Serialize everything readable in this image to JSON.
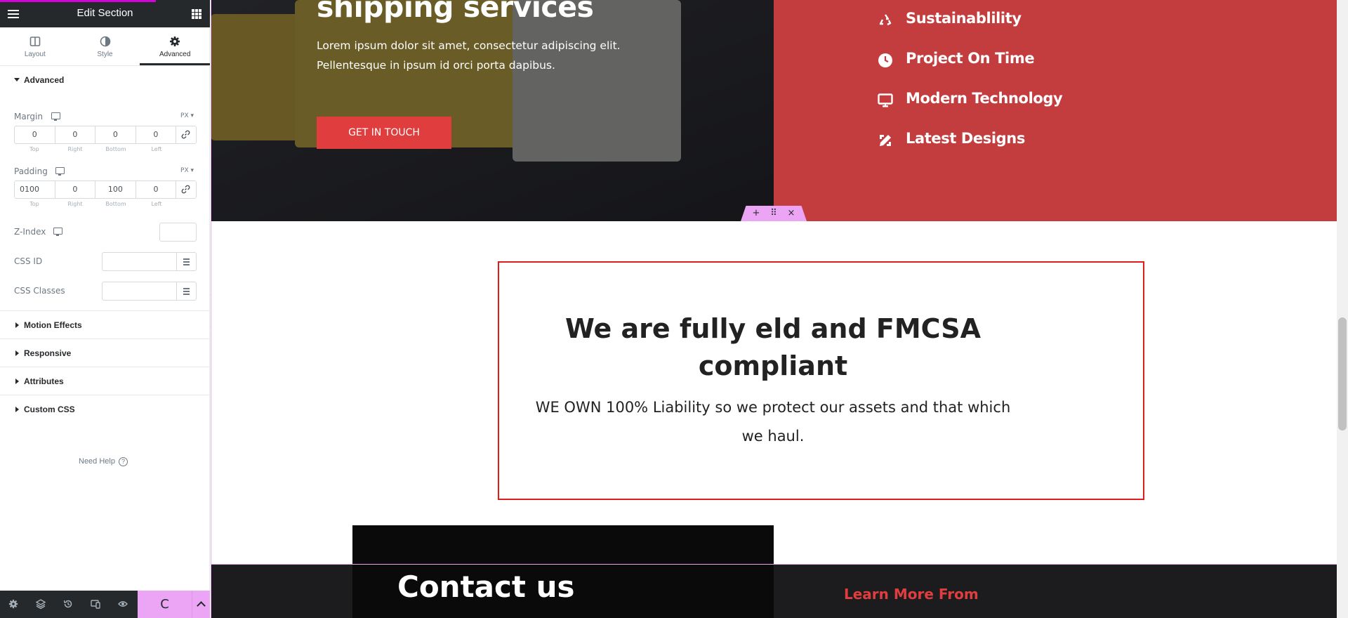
{
  "panel": {
    "title": "Edit Section",
    "tabs": [
      {
        "label": "Layout",
        "icon": "layout-icon"
      },
      {
        "label": "Style",
        "icon": "style-contrast-icon"
      },
      {
        "label": "Advanced",
        "icon": "gear-icon"
      }
    ],
    "active_tab": "Advanced",
    "advanced_section": {
      "title": "Advanced",
      "margin": {
        "label": "Margin",
        "unit": "PX",
        "top": "0",
        "right": "0",
        "bottom": "0",
        "left": "0"
      },
      "padding": {
        "label": "Padding",
        "unit": "PX",
        "top": "0100",
        "right": "0",
        "bottom": "100",
        "left": "0"
      },
      "dim_labels": [
        "Top",
        "Right",
        "Bottom",
        "Left"
      ],
      "z_index": {
        "label": "Z-Index",
        "value": ""
      },
      "css_id": {
        "label": "CSS ID",
        "value": ""
      },
      "css_classes": {
        "label": "CSS Classes",
        "value": ""
      }
    },
    "collapsed_sections": [
      "Motion Effects",
      "Responsive",
      "Attributes",
      "Custom CSS"
    ],
    "need_help": "Need Help",
    "footer": {
      "buttons": [
        "settings-icon",
        "layers-icon",
        "history-icon",
        "responsive-icon",
        "preview-eye-icon"
      ],
      "update_label": "C"
    }
  },
  "preview": {
    "hero": {
      "title": "shipping services",
      "text": "Lorem ipsum dolor sit amet, consectetur adipiscing elit. Pellentesque in ipsum id orci porta dapibus.",
      "cta": "GET IN TOUCH"
    },
    "features": [
      {
        "icon": "recycle-icon",
        "label": "Sustainablility"
      },
      {
        "icon": "clock-icon",
        "label": "Project On Time"
      },
      {
        "icon": "desktop-icon",
        "label": "Modern Technology"
      },
      {
        "icon": "design-tools-icon",
        "label": "Latest Designs"
      }
    ],
    "section_handle": {
      "add": "+",
      "move": "⠿",
      "delete": "×"
    },
    "compliance": {
      "title": "We are fully eld and FMCSA compliant",
      "text": "WE OWN 100% Liability so we protect our assets and that which we haul."
    },
    "contact_title": "Contact us",
    "learn_more": "Learn More From"
  },
  "colors": {
    "panel_header": "#26292c",
    "accent_pink": "#eca5f5",
    "hero_red": "#c43d3e",
    "cta_red": "#e03e3e",
    "compliance_border": "#e21b1b"
  }
}
